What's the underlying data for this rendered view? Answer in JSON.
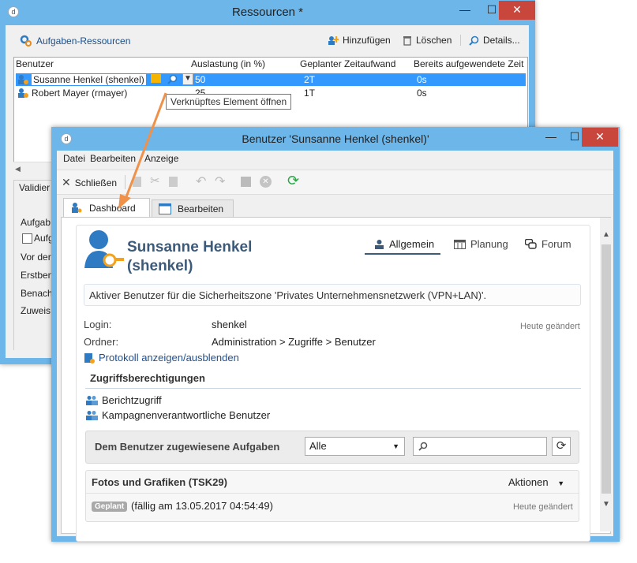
{
  "win1": {
    "title": "Ressourcen *",
    "minimize": "—",
    "maximize": "☐",
    "close": "✕",
    "toolbar": {
      "resources_label": "Aufgaben-Ressourcen",
      "add_label": "Hinzufügen",
      "delete_label": "Löschen",
      "details_label": "Details..."
    },
    "table": {
      "headers": [
        "Benutzer",
        "Auslastung (in %)",
        "Geplanter Zeitaufwand",
        "Bereits aufgewendete Zeit"
      ],
      "rows": [
        {
          "user": "Susanne Henkel (shenkel)",
          "load": "50",
          "planned": "2T",
          "spent": "0s"
        },
        {
          "user": "Robert Mayer (rmayer)",
          "load": "25",
          "planned": "1T",
          "spent": "0s"
        }
      ]
    },
    "tooltip": "Verknüpftes Element öffnen",
    "left_labels": [
      "Validier",
      "Aufgab",
      "Aufg",
      "Vor der",
      "Erstben",
      "Benach",
      "Zuweis"
    ]
  },
  "win2": {
    "title": "Benutzer 'Sunsanne Henkel (shenkel)'",
    "menu": [
      "Datei",
      "Bearbeiten",
      "Anzeige"
    ],
    "close_label": "Schließen",
    "tabs": [
      {
        "label": "Dashboard",
        "active": true
      },
      {
        "label": "Bearbeiten",
        "active": false
      }
    ],
    "profile": {
      "name_line1": "Sunsanne Henkel",
      "name_line2": "(shenkel)",
      "subtabs": [
        "Allgemein",
        "Planung",
        "Forum"
      ],
      "description": "Aktiver Benutzer für die Sicherheitszone 'Privates Unternehmensnetzwerk (VPN+LAN)'.",
      "login_label": "Login:",
      "login_value": "shenkel",
      "changed_today": "Heute geändert",
      "folder_label": "Ordner:",
      "folder_value": "Administration > Zugriffe > Benutzer",
      "log_link": "Protokoll anzeigen/ausblenden",
      "access_title": "Zugriffsberechtigungen",
      "access_items": [
        "Berichtzugriff",
        "Kampagnenverantwortliche Benutzer"
      ],
      "tasks_label": "Dem Benutzer zugewiesene Aufgaben",
      "filter_value": "Alle",
      "search_placeholder": "",
      "task": {
        "title": "Fotos und Grafiken (TSK29)",
        "actions_label": "Aktionen",
        "status_badge": "Geplant",
        "due": "(fällig am 13.05.2017 04:54:49)",
        "changed": "Heute geändert"
      }
    }
  },
  "colors": {
    "titlebar": "#6cb6ea",
    "selection": "#3399ff",
    "close_button": "#c9463d",
    "arrow": "#f0914a",
    "icon_blue": "#2e7bc4",
    "icon_orange": "#f4a11c"
  }
}
